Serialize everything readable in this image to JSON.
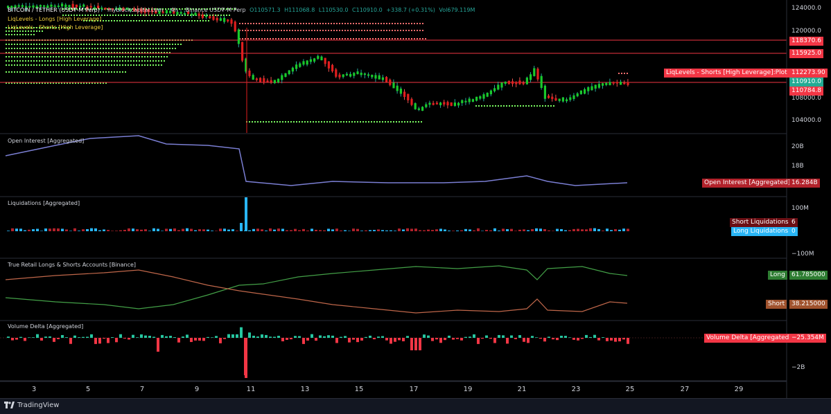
{
  "header": {
    "symbol": "BITCOIN / TETHER (USD₮-M Perp)",
    "source": "myblockcapital.com",
    "timeframe": "4h",
    "exchange": "Binance USD₮-M Perp",
    "o": "O110571.3",
    "h": "H111068.8",
    "l": "L110530.0",
    "c": "C110910.0",
    "change": "+338.7 (+0.31%)",
    "vol": "Vol679.119M",
    "ind1": "LiqLevels - Longs [High Leverage]",
    "ind2": "LiqLevels - Shorts [High Leverage]"
  },
  "price_axis": [
    "124000.0",
    "120000.0",
    "108000.0",
    "104000.0"
  ],
  "price_tags": {
    "p1": "118370.6",
    "p2": "115925.0",
    "plot8_label": "LiqLevels - Shorts [High Leverage]:Plot 8",
    "p3": "112273.90",
    "last": "110910.0",
    "p4": "110784.8"
  },
  "panes": {
    "oi_title": "Open Interest [Aggregated]",
    "oi_axis": [
      "20B",
      "18B"
    ],
    "oi_tag_label": "Open Interest [Aggregated]",
    "oi_tag_value": "16.284B",
    "liq_title": "Liquidations [Aggregated]",
    "liq_axis": [
      "100M",
      "−100M"
    ],
    "short_liq_label": "Short Liquidations",
    "short_liq_value": "6",
    "long_liq_label": "Long Liquidations",
    "long_liq_value": "0",
    "ls_title": "True Retail Longs & Shorts Accounts [Binance]",
    "long_label": "Long",
    "long_value": "61.785000",
    "short_label": "Short",
    "short_value": "38.215000",
    "vd_title": "Volume Delta [Aggregated]",
    "vd_axis": [
      "−2B"
    ],
    "vd_tag_label": "Volume Delta [Aggregated]",
    "vd_tag_value": "−25.354M"
  },
  "dates": [
    "3",
    "5",
    "7",
    "9",
    "11",
    "13",
    "15",
    "17",
    "19",
    "21",
    "23",
    "25",
    "27",
    "29"
  ],
  "footer": {
    "brand": "TradingView"
  },
  "colors": {
    "up": "#26a69a",
    "down": "#ef5350",
    "bg": "#000000",
    "long": "#26a69a",
    "short": "#e07050",
    "accent": "#f23645"
  }
}
